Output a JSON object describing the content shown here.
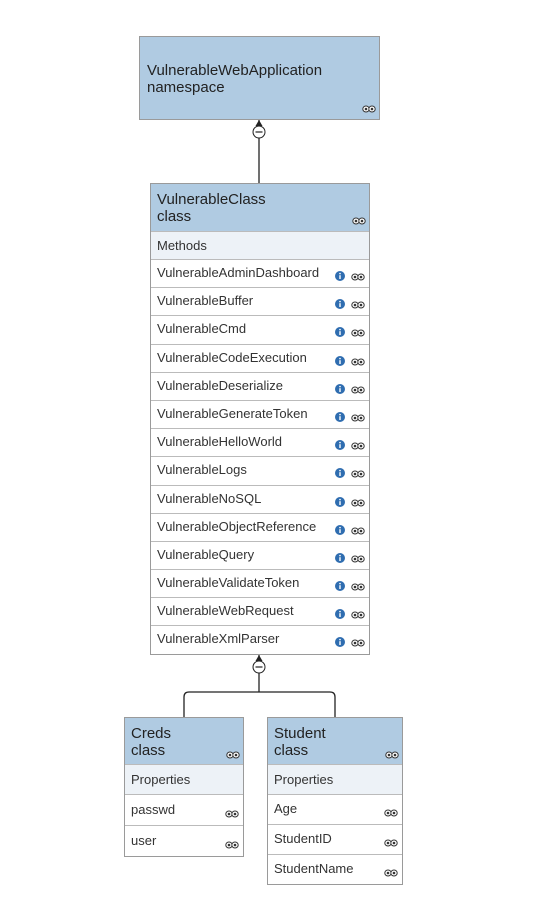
{
  "namespace": {
    "name": "VulnerableWebApplication",
    "kind": "namespace",
    "icon": "eye-icon"
  },
  "vulnerable_class": {
    "name": "VulnerableClass",
    "kind": "class",
    "methods_label": "Methods",
    "methods": [
      "VulnerableAdminDashboard",
      "VulnerableBuffer",
      "VulnerableCmd",
      "VulnerableCodeExecution",
      "VulnerableDeserialize",
      "VulnerableGenerateToken",
      "VulnerableHelloWorld",
      "VulnerableLogs",
      "VulnerableNoSQL",
      "VulnerableObjectReference",
      "VulnerableQuery",
      "VulnerableValidateToken",
      "VulnerableWebRequest",
      "VulnerableXmlParser"
    ]
  },
  "creds_class": {
    "name": "Creds",
    "kind": "class",
    "properties_label": "Properties",
    "properties": [
      "passwd",
      "user"
    ]
  },
  "student_class": {
    "name": "Student",
    "kind": "class",
    "properties_label": "Properties",
    "properties": [
      "Age",
      "StudentID",
      "StudentName"
    ]
  },
  "colors": {
    "header": "#b0cbe2",
    "section": "#edf2f7",
    "border": "#9a9a9a",
    "info_icon": "#2f6db0"
  }
}
